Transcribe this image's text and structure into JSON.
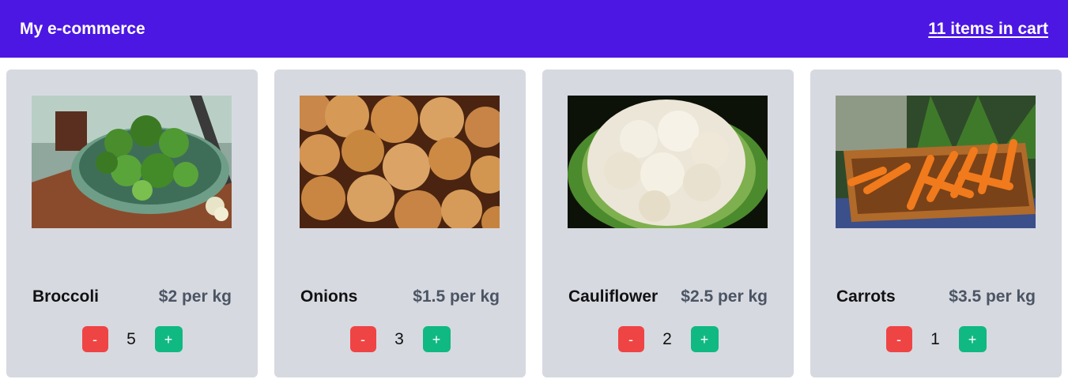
{
  "header": {
    "brand": "My e-commerce",
    "cart_link": "11 items in cart"
  },
  "products": [
    {
      "name": "Broccoli",
      "price": "$2 per kg",
      "quantity": "5",
      "minus_label": "-",
      "plus_label": "+",
      "image": "broccoli-photo"
    },
    {
      "name": "Onions",
      "price": "$1.5 per kg",
      "quantity": "3",
      "minus_label": "-",
      "plus_label": "+",
      "image": "onions-photo"
    },
    {
      "name": "Cauliflower",
      "price": "$2.5 per kg",
      "quantity": "2",
      "minus_label": "-",
      "plus_label": "+",
      "image": "cauliflower-photo"
    },
    {
      "name": "Carrots",
      "price": "$3.5 per kg",
      "quantity": "1",
      "minus_label": "-",
      "plus_label": "+",
      "image": "carrots-photo"
    }
  ],
  "colors": {
    "header_bg": "#4c17e3",
    "card_bg": "#d7d9e1",
    "minus_button": "#ef4444",
    "plus_button": "#10b981",
    "price_text": "#4b5563"
  }
}
